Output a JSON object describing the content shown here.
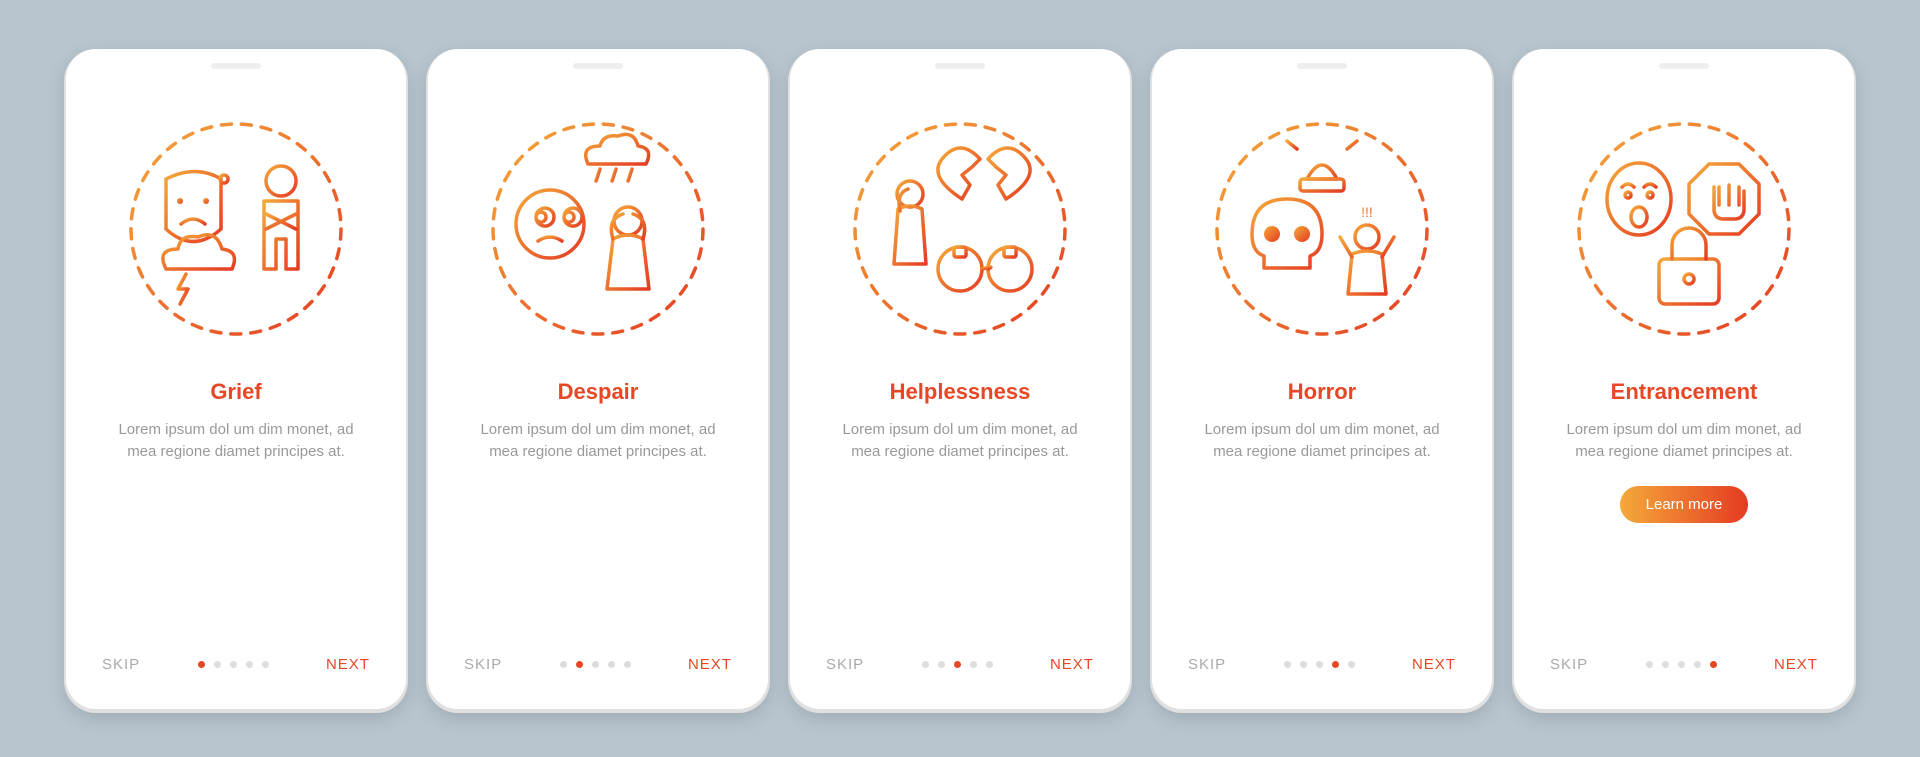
{
  "common": {
    "skip": "SKIP",
    "next": "NEXT",
    "desc": "Lorem ipsum dol um dim monet, ad mea regione diamet principes at.",
    "cta": "Learn more",
    "total_dots": 5
  },
  "screens": [
    {
      "title": "Grief",
      "icon": "grief-icon",
      "active_dot": 0,
      "cta": false
    },
    {
      "title": "Despair",
      "icon": "despair-icon",
      "active_dot": 1,
      "cta": false
    },
    {
      "title": "Helplessness",
      "icon": "helplessness-icon",
      "active_dot": 2,
      "cta": false
    },
    {
      "title": "Horror",
      "icon": "horror-icon",
      "active_dot": 3,
      "cta": false
    },
    {
      "title": "Entrancement",
      "icon": "entrancement-icon",
      "active_dot": 4,
      "cta": true
    }
  ],
  "colors": {
    "accent": "#e84726",
    "grad_a": "#f4a93a",
    "grad_b": "#e53b22"
  }
}
